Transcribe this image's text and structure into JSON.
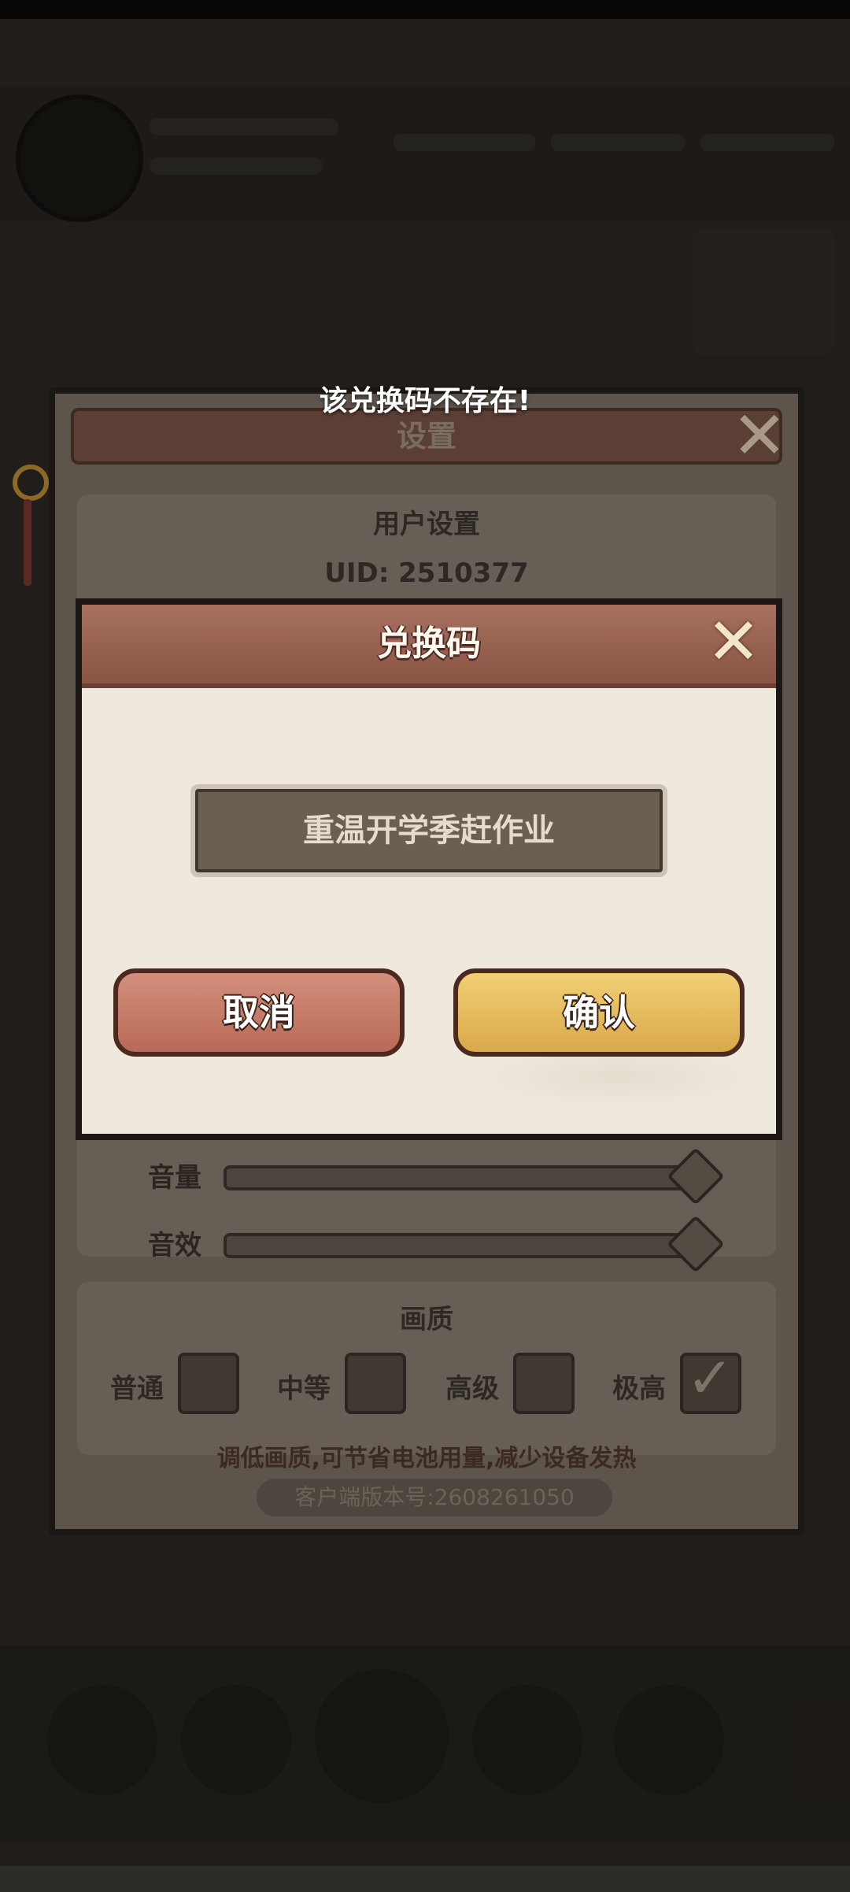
{
  "toast": {
    "message": "该兑换码不存在!"
  },
  "settings": {
    "title": "设置",
    "user_section": {
      "title": "用户设置",
      "uid": "UID: 2510377"
    },
    "audio": {
      "volume_label": "音量",
      "sfx_label": "音效",
      "volume_level": 1.0,
      "sfx_level": 1.0
    },
    "quality": {
      "title": "画质",
      "options": [
        "普通",
        "中等",
        "高级",
        "极高"
      ],
      "selected": "极高",
      "hint": "调低画质,可节省电池用量,减少设备发热"
    },
    "version": "客户端版本号:2608261050"
  },
  "redeem_dialog": {
    "title": "兑换码",
    "code_value": "重温开学季赶作业",
    "cancel_label": "取消",
    "confirm_label": "确认"
  },
  "colors": {
    "header": "#9b6252",
    "cancel": "#c97c68",
    "confirm": "#e9bc5e",
    "dialog_bg": "#efe8dc"
  }
}
